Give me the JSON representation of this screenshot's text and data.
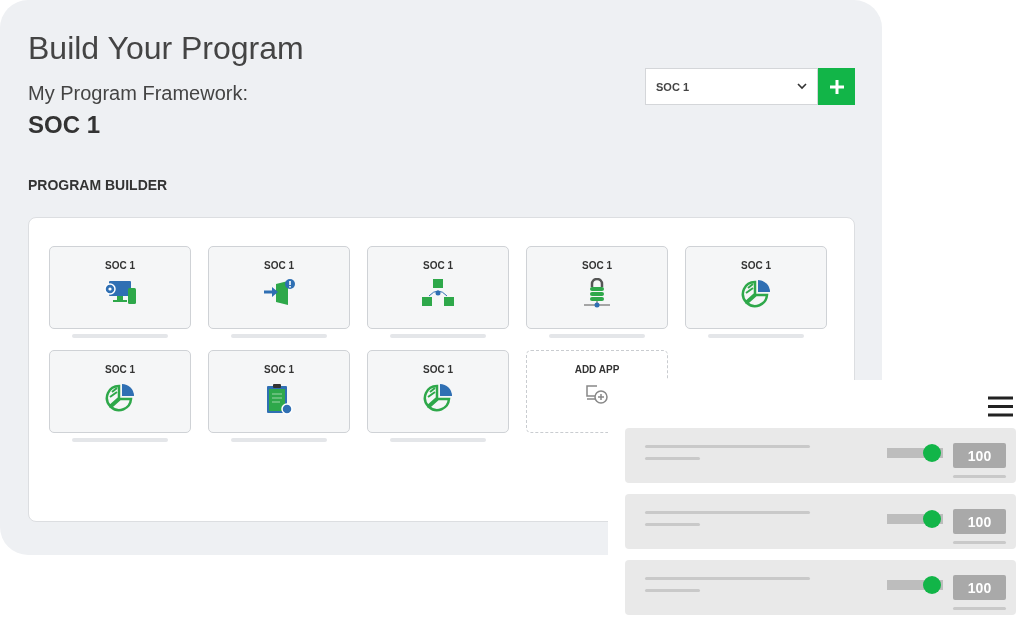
{
  "title": "Build Your Program",
  "framework_label": "My Program Framework:",
  "framework_value": "SOC 1",
  "framework_select": {
    "value": "SOC 1"
  },
  "section_label": "PROGRAM BUILDER",
  "apps": [
    {
      "kind": "devices",
      "label": "SOC 1"
    },
    {
      "kind": "door",
      "label": "SOC 1"
    },
    {
      "kind": "folders",
      "label": "SOC 1"
    },
    {
      "kind": "lock",
      "label": "SOC 1"
    },
    {
      "kind": "pie",
      "label": "SOC 1"
    },
    {
      "kind": "pie",
      "label": "SOC 1"
    },
    {
      "kind": "clipboard",
      "label": "SOC 1"
    },
    {
      "kind": "pie",
      "label": "SOC 1"
    },
    {
      "kind": "add",
      "label": "ADD APP"
    }
  ],
  "rows": [
    {
      "level": 0.9,
      "value": "100"
    },
    {
      "level": 0.9,
      "value": "100"
    },
    {
      "level": 0.9,
      "value": "100"
    }
  ]
}
